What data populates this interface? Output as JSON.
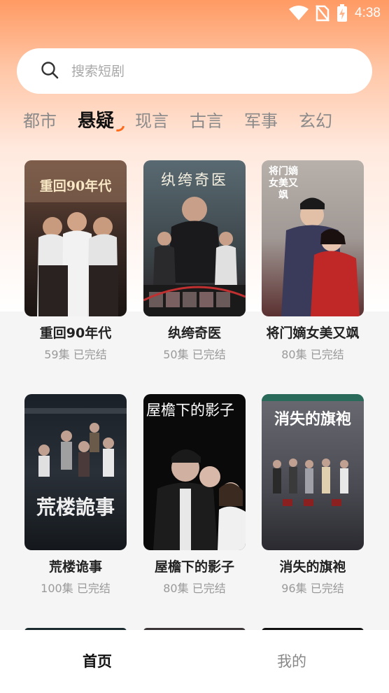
{
  "status_bar": {
    "time": "4:38",
    "icons": [
      "wifi-icon",
      "no-sim-icon",
      "battery-charging-icon"
    ]
  },
  "search": {
    "placeholder": "搜索短剧"
  },
  "tabs": [
    {
      "label": "都市",
      "active": false
    },
    {
      "label": "悬疑",
      "active": true
    },
    {
      "label": "现言",
      "active": false
    },
    {
      "label": "古言",
      "active": false
    },
    {
      "label": "军事",
      "active": false
    },
    {
      "label": "玄幻",
      "active": false
    },
    {
      "label": "",
      "active": false
    }
  ],
  "dramas": [
    {
      "title": "重回90年代",
      "episodes": "59集",
      "status": "已完结",
      "poster_text": "重回90年代"
    },
    {
      "title": "纨绔奇医",
      "episodes": "50集",
      "status": "已完结",
      "poster_text": "纨绔奇医"
    },
    {
      "title": "将门嫡女美又飒",
      "episodes": "80集",
      "status": "已完结",
      "poster_text": "将门嫡女美又飒"
    },
    {
      "title": "荒楼诡事",
      "episodes": "100集",
      "status": "已完结",
      "poster_text": "荒楼詭事"
    },
    {
      "title": "屋檐下的影子",
      "episodes": "80集",
      "status": "已完结",
      "poster_text": "屋檐下的影子"
    },
    {
      "title": "消失的旗袍",
      "episodes": "96集",
      "status": "已完结",
      "poster_text": "消失的旗袍"
    }
  ],
  "bottom_nav": [
    {
      "label": "首页",
      "active": true
    },
    {
      "label": "我的",
      "active": false
    }
  ],
  "colors": {
    "accent": "#ff6a1a",
    "gradient_top": "#ff9a63",
    "background": "#f5f5f5"
  }
}
